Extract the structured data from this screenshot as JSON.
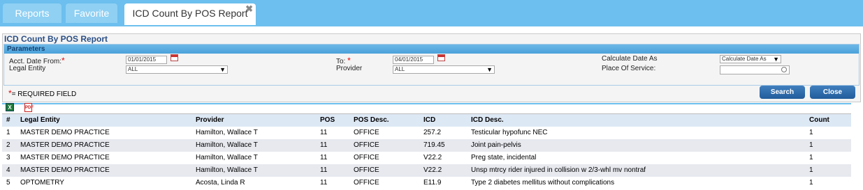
{
  "tabs": [
    {
      "label": "Reports"
    },
    {
      "label": "Favorite"
    },
    {
      "label": "ICD Count By POS Report",
      "close": "✖"
    }
  ],
  "report": {
    "title": "ICD Count By POS Report",
    "params_header": "Parameters",
    "acct_from_label": "Acct. Date From:",
    "acct_from_value": "01/01/2015",
    "to_label": "To:",
    "to_value": "04/01/2015",
    "calc_label": "Calculate Date As",
    "calc_value": "Calculate Date As",
    "legal_entity_label": "Legal Entity",
    "legal_entity_value": "ALL",
    "provider_label": "Provider",
    "provider_value": "ALL",
    "pos_label": "Place Of Service:",
    "pos_value": "",
    "required_star": "*",
    "required_note": "= REQUIRED FIELD",
    "search_label": "Search",
    "close_label": "Close"
  },
  "export": {
    "excel_icon": "excel-icon",
    "pdf_icon": "pdf-icon",
    "xls_text": "X",
    "pdf_text": "PDF"
  },
  "table": {
    "headers": [
      "#",
      "Legal Entity",
      "Provider",
      "POS",
      "POS Desc.",
      "ICD",
      "ICD Desc.",
      "Count"
    ],
    "rows": [
      [
        "1",
        "MASTER DEMO PRACTICE",
        "Hamilton, Wallace T",
        "11",
        "OFFICE",
        "257.2",
        "Testicular hypofunc NEC",
        "1"
      ],
      [
        "2",
        "MASTER DEMO PRACTICE",
        "Hamilton, Wallace T",
        "11",
        "OFFICE",
        "719.45",
        "Joint pain-pelvis",
        "1"
      ],
      [
        "3",
        "MASTER DEMO PRACTICE",
        "Hamilton, Wallace T",
        "11",
        "OFFICE",
        "V22.2",
        "Preg state, incidental",
        "1"
      ],
      [
        "4",
        "MASTER DEMO PRACTICE",
        "Hamilton, Wallace T",
        "11",
        "OFFICE",
        "V22.2",
        "Unsp mtrcy rider injured in collision w 2/3-whl mv nontraf",
        "1"
      ],
      [
        "5",
        "OPTOMETRY",
        "Acosta, Linda R",
        "11",
        "OFFICE",
        "E11.9",
        "Type 2 diabetes mellitus without complications",
        "1"
      ]
    ]
  },
  "colors": {
    "tabbar": "#6cbfee",
    "button": "#225c9b",
    "header_row": "#dde8f5"
  }
}
